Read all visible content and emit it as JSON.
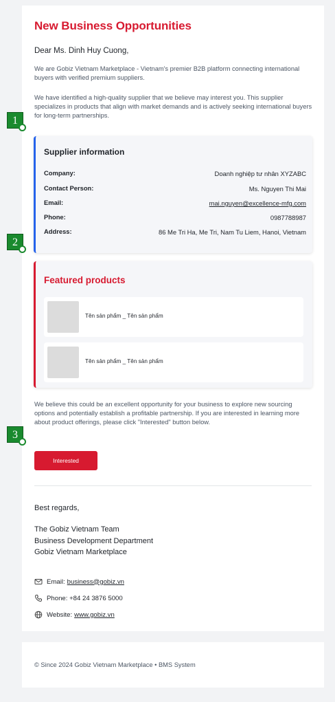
{
  "email": {
    "title": "New Business Opportunities",
    "greeting": "Dear Ms. Dinh Huy Cuong,",
    "intro": "We are Gobiz Vietnam Marketplace - Vietnam's premier B2B platform connecting international buyers with verified premium suppliers.",
    "identified": "We have identified a high-quality supplier that we believe may interest you. This supplier specializes in products that align with market demands and is actively seeking international buyers for long-term partnerships.",
    "closing_para": "We believe this could be an excellent opportunity for your business to explore new sourcing options and potentially establish a profitable partnership. If you are interested in learning more about product offerings, please click \"Interested\" button below.",
    "interested_button": "Interested",
    "regards": "Best regards,",
    "team_lines": [
      "The Gobiz Vietnam Team",
      "Business Development Department",
      "Gobiz Vietnam Marketplace"
    ]
  },
  "supplier": {
    "heading": "Supplier information",
    "rows": [
      {
        "label": "Company:",
        "value": "Doanh nghiệp tư nhân XYZABC"
      },
      {
        "label": "Contact Person:",
        "value": "Ms. Nguyen Thi Mai"
      },
      {
        "label": "Email:",
        "value": "mai.nguyen@excellence-mfg.com"
      },
      {
        "label": "Phone:",
        "value": "0987788987"
      },
      {
        "label": "Address:",
        "value": "86 Me Tri Ha, Me Tri, Nam Tu Liem, Hanoi, Vietnam"
      }
    ]
  },
  "featured": {
    "heading": "Featured products",
    "products": [
      {
        "name": "Tên sản phẩm _ Tên sản phẩm"
      },
      {
        "name": "Tên sản phẩm _ Tên sản phẩm"
      }
    ]
  },
  "contact": {
    "email_label": "Email:",
    "email_value": "business@gobiz.vn",
    "phone_label": "Phone: +84 24 3876 5000",
    "website_label": "Website:",
    "website_value": "www.gobiz.vn"
  },
  "footer": {
    "text": "© Since 2024 Gobiz Vietnam Marketplace • BMS System"
  },
  "markers": [
    "1",
    "2",
    "3"
  ],
  "colors": {
    "accent": "#d71a30",
    "supplier_border": "#2563eb",
    "marker": "#1a8a2e"
  }
}
